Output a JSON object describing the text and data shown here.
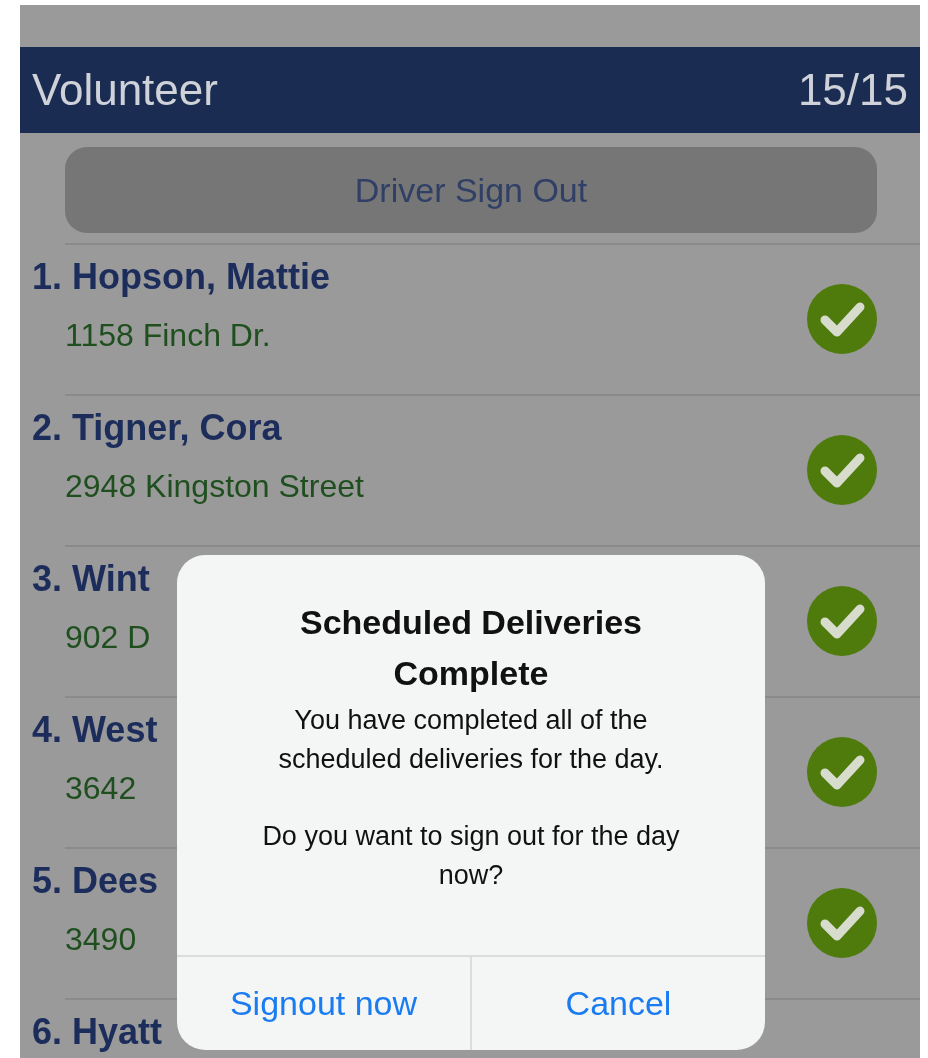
{
  "header": {
    "title": "Volunteer",
    "count": "15/15"
  },
  "sign_out_button": "Driver Sign Out",
  "deliveries": [
    {
      "name": "1. Hopson, Mattie",
      "address": "1158 Finch Dr.",
      "completed": true
    },
    {
      "name": "2. Tigner, Cora",
      "address": "2948 Kingston Street",
      "completed": true
    },
    {
      "name": "3. Wint",
      "address": "902 D",
      "completed": true
    },
    {
      "name": "4. West",
      "address": "3642",
      "completed": true
    },
    {
      "name": "5. Dees",
      "address": "3490",
      "completed": true
    },
    {
      "name": "6. Hyatt"
    }
  ],
  "alert": {
    "title": "Scheduled Deliveries Complete",
    "message": "You have completed all of the scheduled deliveries for the day.",
    "question": "Do you want to sign out for the day now?",
    "buttons": [
      {
        "label": "Signout now"
      },
      {
        "label": "Cancel"
      }
    ]
  }
}
